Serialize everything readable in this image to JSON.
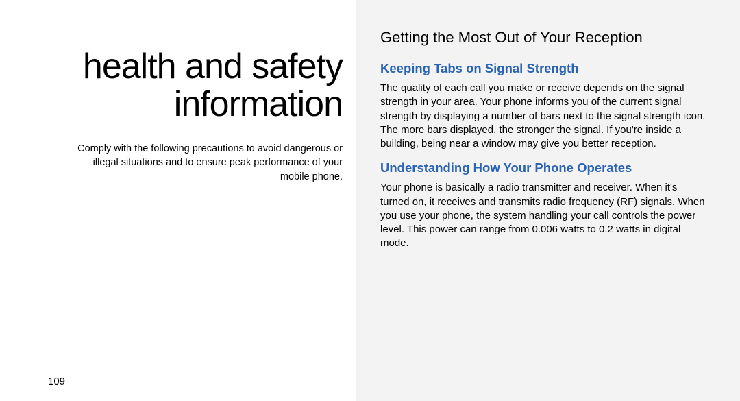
{
  "left": {
    "title_line1": "health and safety",
    "title_line2": "information",
    "intro": "Comply with the following precautions to avoid dangerous or illegal situations and to ensure peak performance of your mobile phone.",
    "page_number": "109"
  },
  "right": {
    "section_title": "Getting the Most Out of Your Reception",
    "subsection1": {
      "heading": "Keeping Tabs on Signal Strength",
      "body": "The quality of each call you make or receive depends on the signal strength in your area. Your phone informs you of the current signal strength by displaying a number of bars next to the signal strength icon. The more bars displayed, the stronger the signal. If you're inside a building, being near a window may give you better reception."
    },
    "subsection2": {
      "heading": "Understanding How Your Phone Operates",
      "body": "Your phone is basically a radio transmitter and receiver. When it's turned on, it receives and transmits radio frequency (RF) signals. When you use your phone, the system handling your call controls the power level. This power can range from 0.006 watts to 0.2 watts in digital mode."
    }
  }
}
